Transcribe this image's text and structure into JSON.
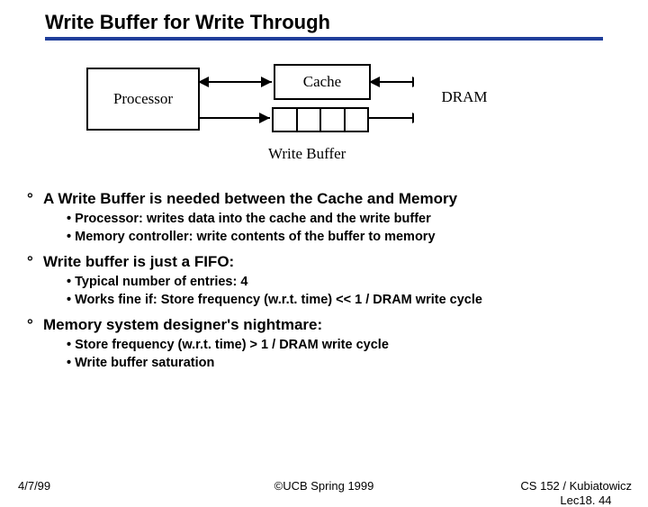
{
  "title": "Write Buffer for Write Through",
  "diagram": {
    "processor": "Processor",
    "cache": "Cache",
    "dram": "DRAM",
    "write_buffer_label": "Write Buffer"
  },
  "bullets": [
    {
      "head": "A Write Buffer is needed between the Cache and Memory",
      "subs": [
        "Processor: writes data into the cache and the write buffer",
        "Memory controller: write contents of the buffer to memory"
      ]
    },
    {
      "head": "Write buffer is just a FIFO:",
      "subs": [
        "Typical number of entries: 4",
        "Works fine if:  Store frequency (w.r.t. time) << 1 / DRAM write cycle"
      ]
    },
    {
      "head": "Memory system designer's nightmare:",
      "subs": [
        "Store frequency (w.r.t. time) >  1 / DRAM write cycle",
        "Write buffer saturation"
      ]
    }
  ],
  "footer": {
    "left": "4/7/99",
    "center": "©UCB Spring 1999",
    "right1": "CS 152 / Kubiatowicz",
    "right2": "Lec18. 44"
  }
}
